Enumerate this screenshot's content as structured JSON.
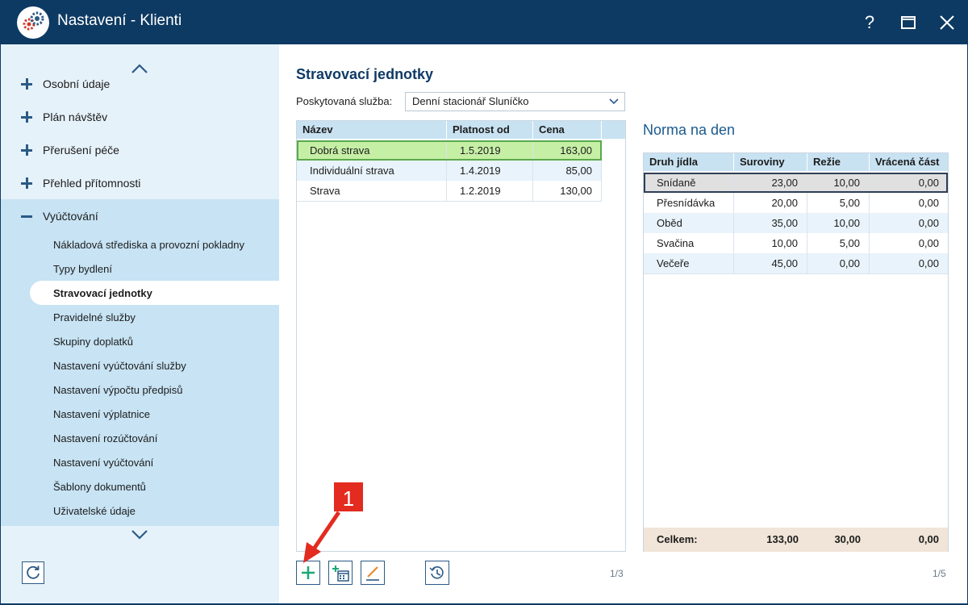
{
  "window": {
    "title": "Nastavení - Klienti",
    "help_label": "?"
  },
  "sidebar": {
    "items": [
      {
        "label": "Osobní údaje"
      },
      {
        "label": "Plán návštěv"
      },
      {
        "label": "Přerušení péče"
      },
      {
        "label": "Přehled přítomnosti"
      },
      {
        "label": "Vyúčtování"
      }
    ],
    "subitems": [
      {
        "label": "Nákladová střediska a provozní pokladny"
      },
      {
        "label": "Typy bydlení"
      },
      {
        "label": "Stravovací jednotky"
      },
      {
        "label": "Pravidelné služby"
      },
      {
        "label": "Skupiny doplatků"
      },
      {
        "label": "Nastavení vyúčtování služby"
      },
      {
        "label": "Nastavení výpočtu předpisů"
      },
      {
        "label": "Nastavení výplatnice"
      },
      {
        "label": "Nastavení rozúčtování"
      },
      {
        "label": "Nastavení vyúčtování"
      },
      {
        "label": "Šablony dokumentů"
      },
      {
        "label": "Uživatelské údaje"
      }
    ]
  },
  "main": {
    "title": "Stravovací jednotky",
    "service_label": "Poskytovaná služba:",
    "service_value": "Denní stacionář Sluníčko",
    "units_table": {
      "columns": [
        "Název",
        "Platnost od",
        "Cena"
      ],
      "rows": [
        {
          "name": "Dobrá strava",
          "valid_from": "1.5.2019",
          "price": "163,00"
        },
        {
          "name": "Individuální strava",
          "valid_from": "1.4.2019",
          "price": "85,00"
        },
        {
          "name": "Strava",
          "valid_from": "1.2.2019",
          "price": "130,00"
        }
      ],
      "pager": "1/3"
    },
    "norma": {
      "title": "Norma na den",
      "columns": [
        "Druh jídla",
        "Suroviny",
        "Režie",
        "Vrácená část"
      ],
      "rows": [
        {
          "meal": "Snídaně",
          "ingredients": "23,00",
          "overhead": "10,00",
          "returned": "0,00"
        },
        {
          "meal": "Přesnídávka",
          "ingredients": "20,00",
          "overhead": "5,00",
          "returned": "0,00"
        },
        {
          "meal": "Oběd",
          "ingredients": "35,00",
          "overhead": "10,00",
          "returned": "0,00"
        },
        {
          "meal": "Svačina",
          "ingredients": "10,00",
          "overhead": "5,00",
          "returned": "0,00"
        },
        {
          "meal": "Večeře",
          "ingredients": "45,00",
          "overhead": "0,00",
          "returned": "0,00"
        }
      ],
      "total": {
        "label": "Celkem:",
        "ingredients": "133,00",
        "overhead": "30,00",
        "returned": "0,00"
      },
      "pager": "1/5"
    },
    "callout_number": "1"
  },
  "icons": {
    "logo": "gears-icon",
    "add": "plus-icon",
    "add_dated": "calendar-plus-icon",
    "edit": "pencil-icon",
    "history": "history-icon",
    "refresh": "refresh-icon"
  },
  "colors": {
    "titlebar": "#0d3a62",
    "sidebar": "#e6f2fa",
    "sidebar_group": "#c7e3f4",
    "grid_header": "#c8e2f2",
    "selected_row": "#c6efa6",
    "callout": "#e32b20"
  }
}
